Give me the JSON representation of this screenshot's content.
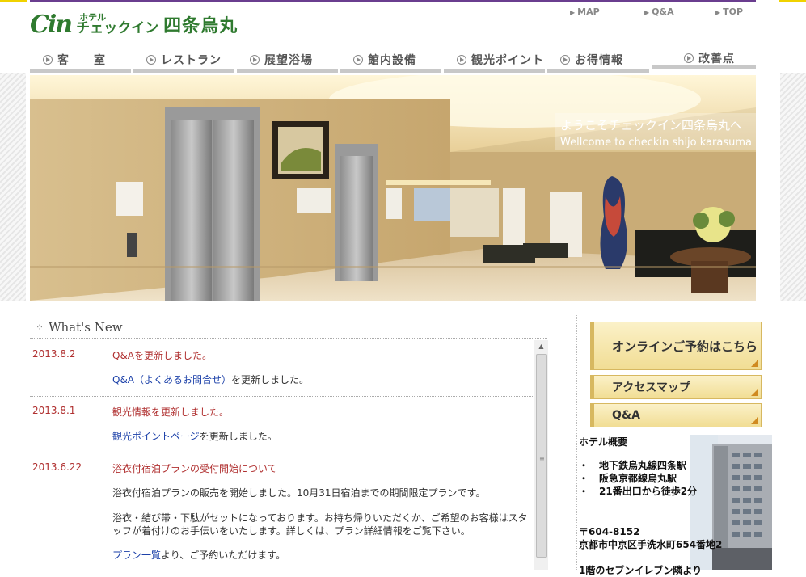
{
  "brand": {
    "mark": "Cin",
    "small": "ホテル",
    "main": "チェックイン",
    "kanji": "四条烏丸",
    "green": "#2f7a2f",
    "purple": "#6a3d8f",
    "yellow": "#f0d200"
  },
  "toplinks": [
    "MAP",
    "Q&A",
    "TOP"
  ],
  "nav": [
    {
      "label": "客　　室"
    },
    {
      "label": "レストラン"
    },
    {
      "label": "展望浴場"
    },
    {
      "label": "館内設備"
    },
    {
      "label": "観光ポイント"
    },
    {
      "label": "お得情報"
    },
    {
      "label": "改善点"
    }
  ],
  "hero": {
    "caption_jp": "ようこそチェックイン四条烏丸へ",
    "caption_en": "Wellcome to checkin shijo karasuma"
  },
  "news": {
    "heading": "What's New",
    "entries": [
      {
        "date": "2013.8.2",
        "title": "Q&Aを更新しました。",
        "link": "Q&A（よくあるお問合せ）",
        "rest": "を更新しました。"
      },
      {
        "date": "2013.8.1",
        "title": "観光情報を更新しました。",
        "link": "観光ポイントページ",
        "rest": "を更新しました。"
      },
      {
        "date": "2013.6.22",
        "title": "浴衣付宿泊プランの受付開始について",
        "para1": "浴衣付宿泊プランの販売を開始しました。10月31日宿泊までの期間限定プランです。",
        "para2": "浴衣・結び帯・下駄がセットになっております。お持ち帰りいただくか、ご希望のお客様はスタッフが着付けのお手伝いをいたします。詳しくは、プラン詳細情報をご覧下さい。",
        "link": "プラン一覧",
        "rest": "より、ご予約いただけます。"
      }
    ]
  },
  "sidebar": {
    "reserve": "オンラインご予約はこちら",
    "access": "アクセスマップ",
    "qa": "Q&A",
    "hotel_title": "ホテル概要",
    "bullets": [
      "地下鉄烏丸線四条駅",
      "阪急京都線烏丸駅",
      "21番出口から徒歩2分"
    ],
    "bullet_mark": "・",
    "zip": "〒604-8152",
    "address": "京都市中京区手洗水町654番地2",
    "cut_line": "1階のセブンイレブン隣より"
  }
}
